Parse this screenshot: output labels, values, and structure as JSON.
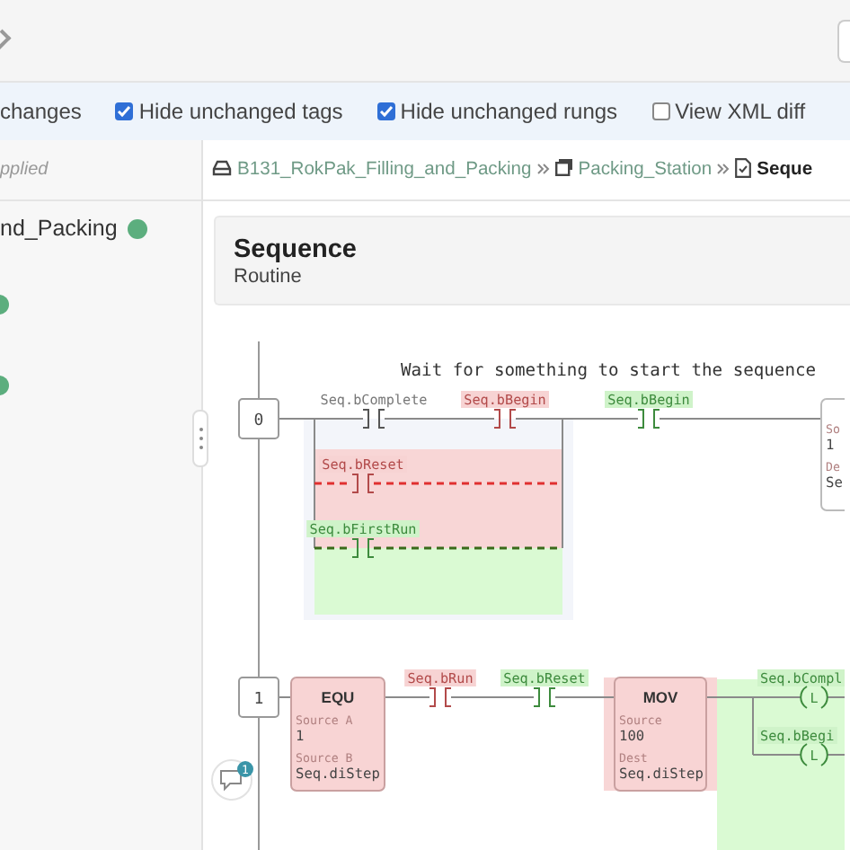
{
  "options": {
    "partial_label": "changes",
    "checkboxes": [
      {
        "label": "Hide unchanged tags",
        "checked": true
      },
      {
        "label": "Hide unchanged rungs",
        "checked": true
      },
      {
        "label": "View XML diff",
        "checked": false
      }
    ]
  },
  "sidebar": {
    "caption": "pplied",
    "items": [
      {
        "label": "nd_Packing",
        "verified": true
      }
    ]
  },
  "breadcrumb": [
    {
      "label": "B131_RokPak_Filling_and_Packing",
      "kind": "controller",
      "current": false
    },
    {
      "label": "Packing_Station",
      "kind": "program",
      "current": false
    },
    {
      "label": "Seque",
      "kind": "routine",
      "current": true
    }
  ],
  "routine": {
    "title": "Sequence",
    "subtitle": "Routine"
  },
  "rungs": [
    {
      "number": "0",
      "comment": "Wait for something to start the sequence",
      "elements": [
        {
          "kind": "contact",
          "tag": "Seq.bComplete",
          "added": false,
          "removed": false
        },
        {
          "kind": "contact",
          "tag": "Seq.bBegin",
          "added": false,
          "removed": true
        },
        {
          "kind": "contact",
          "tag": "Seq.bBegin",
          "added": true,
          "removed": false
        },
        {
          "kind": "instruction",
          "added": false,
          "removed": false,
          "operands": [
            {
              "label": "So",
              "value": "1"
            },
            {
              "label": "De",
              "value": "Se"
            }
          ]
        },
        {
          "kind": "contact",
          "tag": "Seq.bReset",
          "added": false,
          "removed": true
        },
        {
          "kind": "contact",
          "tag": "Seq.bFirstRun",
          "added": true,
          "removed": false
        }
      ]
    },
    {
      "number": "1",
      "elements": [
        {
          "kind": "instruction",
          "name": "EQU",
          "added": false,
          "removed": true,
          "operands": [
            {
              "label": "Source A",
              "value": "1"
            },
            {
              "label": "Source B",
              "value": "Seq.diStep"
            }
          ]
        },
        {
          "kind": "contact",
          "tag": "Seq.bRun",
          "added": false,
          "removed": true
        },
        {
          "kind": "contact",
          "tag": "Seq.bReset",
          "added": true,
          "removed": false
        },
        {
          "kind": "instruction",
          "name": "MOV",
          "added": false,
          "removed": true,
          "operands": [
            {
              "label": "Source",
              "value": "100"
            },
            {
              "label": "Dest",
              "value": "Seq.diStep"
            }
          ]
        },
        {
          "kind": "coil",
          "tag": "Seq.bCompl",
          "symbol": "L",
          "added": true,
          "removed": false
        },
        {
          "kind": "coil",
          "tag": "Seq.bBegi",
          "symbol": "L",
          "added": true,
          "removed": false
        }
      ]
    }
  ],
  "chat": {
    "badge": "1"
  }
}
